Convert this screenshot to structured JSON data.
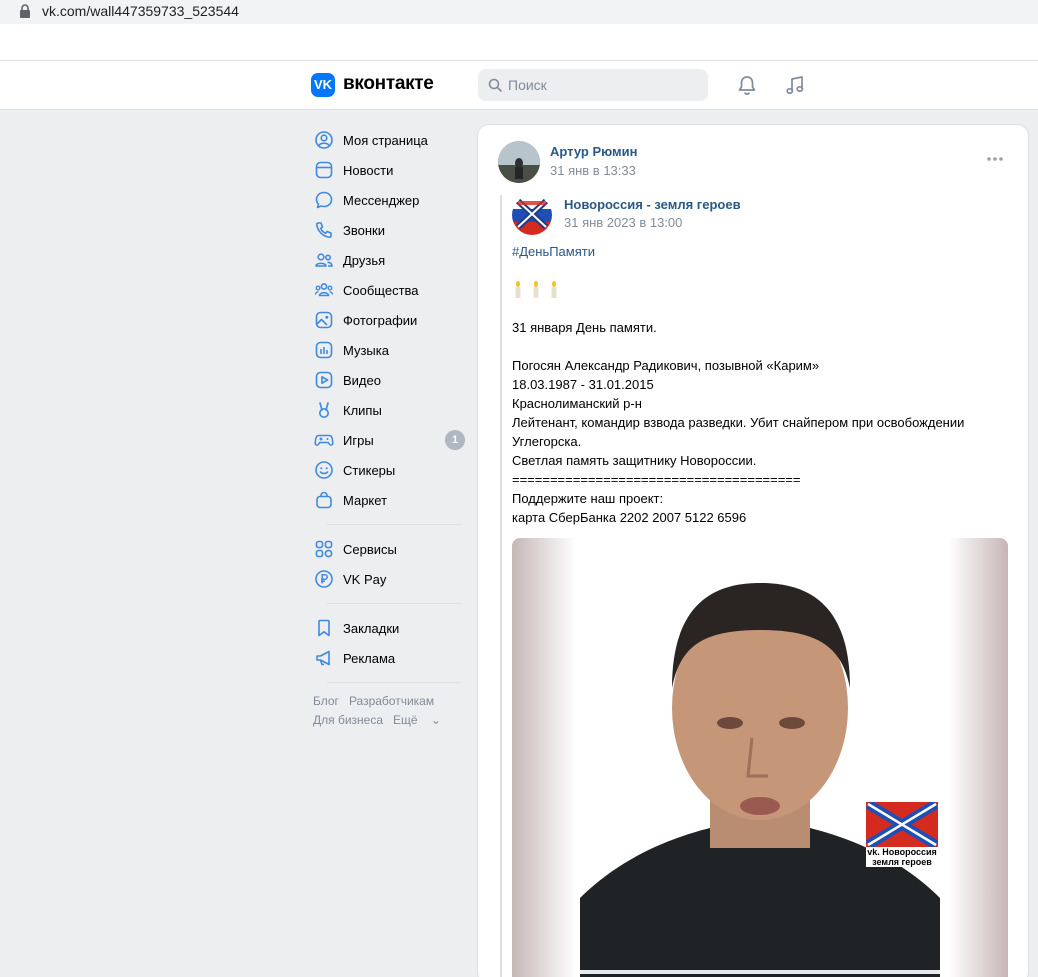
{
  "browser": {
    "url": "vk.com/wall447359733_523544"
  },
  "header": {
    "logo_glyph": "VK",
    "wordmark": "вконтакте",
    "search_placeholder": "Поиск"
  },
  "menu": {
    "items": [
      {
        "label": "Моя страница",
        "icon": "profile-icon"
      },
      {
        "label": "Новости",
        "icon": "news-icon"
      },
      {
        "label": "Мессенджер",
        "icon": "messenger-icon"
      },
      {
        "label": "Звонки",
        "icon": "phone-icon"
      },
      {
        "label": "Друзья",
        "icon": "friends-icon"
      },
      {
        "label": "Сообщества",
        "icon": "communities-icon"
      },
      {
        "label": "Фотографии",
        "icon": "photos-icon"
      },
      {
        "label": "Музыка",
        "icon": "music-icon"
      },
      {
        "label": "Видео",
        "icon": "video-icon"
      },
      {
        "label": "Клипы",
        "icon": "clips-icon"
      },
      {
        "label": "Игры",
        "icon": "games-icon",
        "badge": "1"
      },
      {
        "label": "Стикеры",
        "icon": "stickers-icon"
      },
      {
        "label": "Маркет",
        "icon": "market-icon"
      }
    ],
    "items2": [
      {
        "label": "Сервисы",
        "icon": "services-icon"
      },
      {
        "label": "VK Pay",
        "icon": "vkpay-icon"
      }
    ],
    "items3": [
      {
        "label": "Закладки",
        "icon": "bookmarks-icon"
      },
      {
        "label": "Реклама",
        "icon": "ads-icon"
      }
    ],
    "footer": {
      "blog": "Блог",
      "developers": "Разработчикам",
      "business": "Для бизнеса",
      "more": "Ещё"
    }
  },
  "post": {
    "author": "Артур Рюмин",
    "time": "31 янв в 13:33",
    "repost": {
      "group": "Новороссия - земля героев",
      "time": "31 янв 2023 в 13:00",
      "hashtag": "#ДеньПамяти",
      "lines": [
        "31 января День памяти.",
        "",
        "Погосян Александр Радикович, позывной «Карим»",
        "18.03.1987 - 31.01.2015",
        "Краснолиманский р-н",
        "Лейтенант, командир взвода разведки. Убит снайпером при освобождении",
        "Углегорска.",
        "Светлая память защитнику Новороссии.",
        "======================================",
        "Поддержите наш проект:",
        "карта СберБанка 2202 2007 5122 6596"
      ],
      "photo_caption_line1": "vk. Новороссия",
      "photo_caption_line2": "земля героев"
    }
  }
}
